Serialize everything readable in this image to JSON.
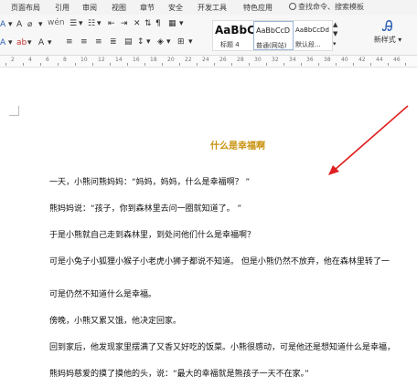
{
  "menu": {
    "tabs": [
      "页面布局",
      "引用",
      "审阅",
      "视图",
      "章节",
      "安全",
      "开发工具",
      "特色应用"
    ],
    "search_text": "查找命令、搜索模板"
  },
  "ribbon": {
    "styles": [
      {
        "preview": "AaBbC",
        "label": "标题 4"
      },
      {
        "preview": "AaBbCcD",
        "label": "普通(网站)"
      },
      {
        "preview": "AaBbCcDd",
        "label": "默认段..."
      }
    ],
    "new_style_label": "新样式",
    "font_tools": [
      "A",
      "A",
      "⌀",
      "▾"
    ]
  },
  "ruler": {
    "numbers": [
      "2",
      "4",
      "6",
      "8",
      "10",
      "12",
      "14",
      "16",
      "18",
      "20",
      "22",
      "24",
      "26",
      "28",
      "30",
      "32",
      "34",
      "36",
      "38",
      "40",
      "42",
      "44",
      "46"
    ]
  },
  "document": {
    "title": "什么是幸福啊",
    "paragraphs": [
      "一天，小熊问熊妈妈：“妈妈，妈妈，什么是幸福啊？ ”",
      "熊妈妈说：“孩子，你到森林里去问一圈就知道了。 ”",
      "于是小熊就自己走到森林里，到处问他们什么是幸福啊？",
      "可是小兔子小狐狸小猴子小老虎小狮子都说不知道。 但是小熊仍然不放弃，他在森林里转了一",
      "可是仍然不知道什么是幸福。",
      "傍晚，小熊又累又饿，他决定回家。",
      "回到家后，他发现家里摆满了又香又好吃的饭菜。小熊很感动，可是他还是想知道什么是幸福，",
      "熊妈妈慈爱的摸了摸他的头，说：“最大的幸福就是熊孩子一天不在家。”"
    ]
  },
  "colors": {
    "title": "#c8920f",
    "arrow": "#e02020",
    "menu_bg": "#f3f3f3"
  }
}
